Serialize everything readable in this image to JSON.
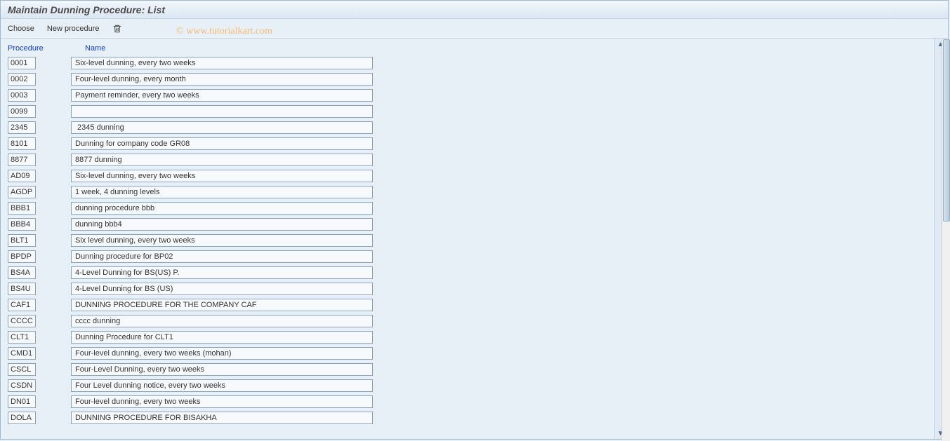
{
  "title": "Maintain Dunning Procedure: List",
  "toolbar": {
    "choose_label": "Choose",
    "new_procedure_label": "New procedure",
    "delete_icon": "trash"
  },
  "watermark": "©  www.tutorialkart.com",
  "columns": {
    "procedure": "Procedure",
    "name": "Name"
  },
  "rows": [
    {
      "proc": "0001",
      "name": "Six-level dunning, every two weeks"
    },
    {
      "proc": "0002",
      "name": "Four-level dunning, every month"
    },
    {
      "proc": "0003",
      "name": "Payment reminder, every two weeks"
    },
    {
      "proc": "0099",
      "name": ""
    },
    {
      "proc": "2345",
      "name": " 2345 dunning"
    },
    {
      "proc": "8101",
      "name": "Dunning for company code GR08"
    },
    {
      "proc": "8877",
      "name": "8877 dunning"
    },
    {
      "proc": "AD09",
      "name": "Six-level dunning, every two weeks"
    },
    {
      "proc": "AGDP",
      "name": "1 week, 4 dunning levels"
    },
    {
      "proc": "BBB1",
      "name": "dunning procedure bbb"
    },
    {
      "proc": "BBB4",
      "name": "dunning bbb4"
    },
    {
      "proc": "BLT1",
      "name": "Six level dunning, every two weeks"
    },
    {
      "proc": "BPDP",
      "name": "Dunning procedure for BP02"
    },
    {
      "proc": "BS4A",
      "name": "4-Level Dunning for BS(US) P."
    },
    {
      "proc": "BS4U",
      "name": "4-Level Dunning for BS (US)"
    },
    {
      "proc": "CAF1",
      "name": "DUNNING PROCEDURE FOR THE COMPANY CAF"
    },
    {
      "proc": "CCCC",
      "name": "cccc dunning"
    },
    {
      "proc": "CLT1",
      "name": "Dunning Procedure for CLT1"
    },
    {
      "proc": "CMD1",
      "name": "Four-level dunning, every two weeks (mohan)"
    },
    {
      "proc": "CSCL",
      "name": "Four-Level Dunning, every two weeks"
    },
    {
      "proc": "CSDN",
      "name": "Four Level dunning notice, every two weeks"
    },
    {
      "proc": "DN01",
      "name": "Four-level dunning, every two weeks"
    },
    {
      "proc": "DOLA",
      "name": "DUNNING PROCEDURE FOR BISAKHA"
    }
  ]
}
